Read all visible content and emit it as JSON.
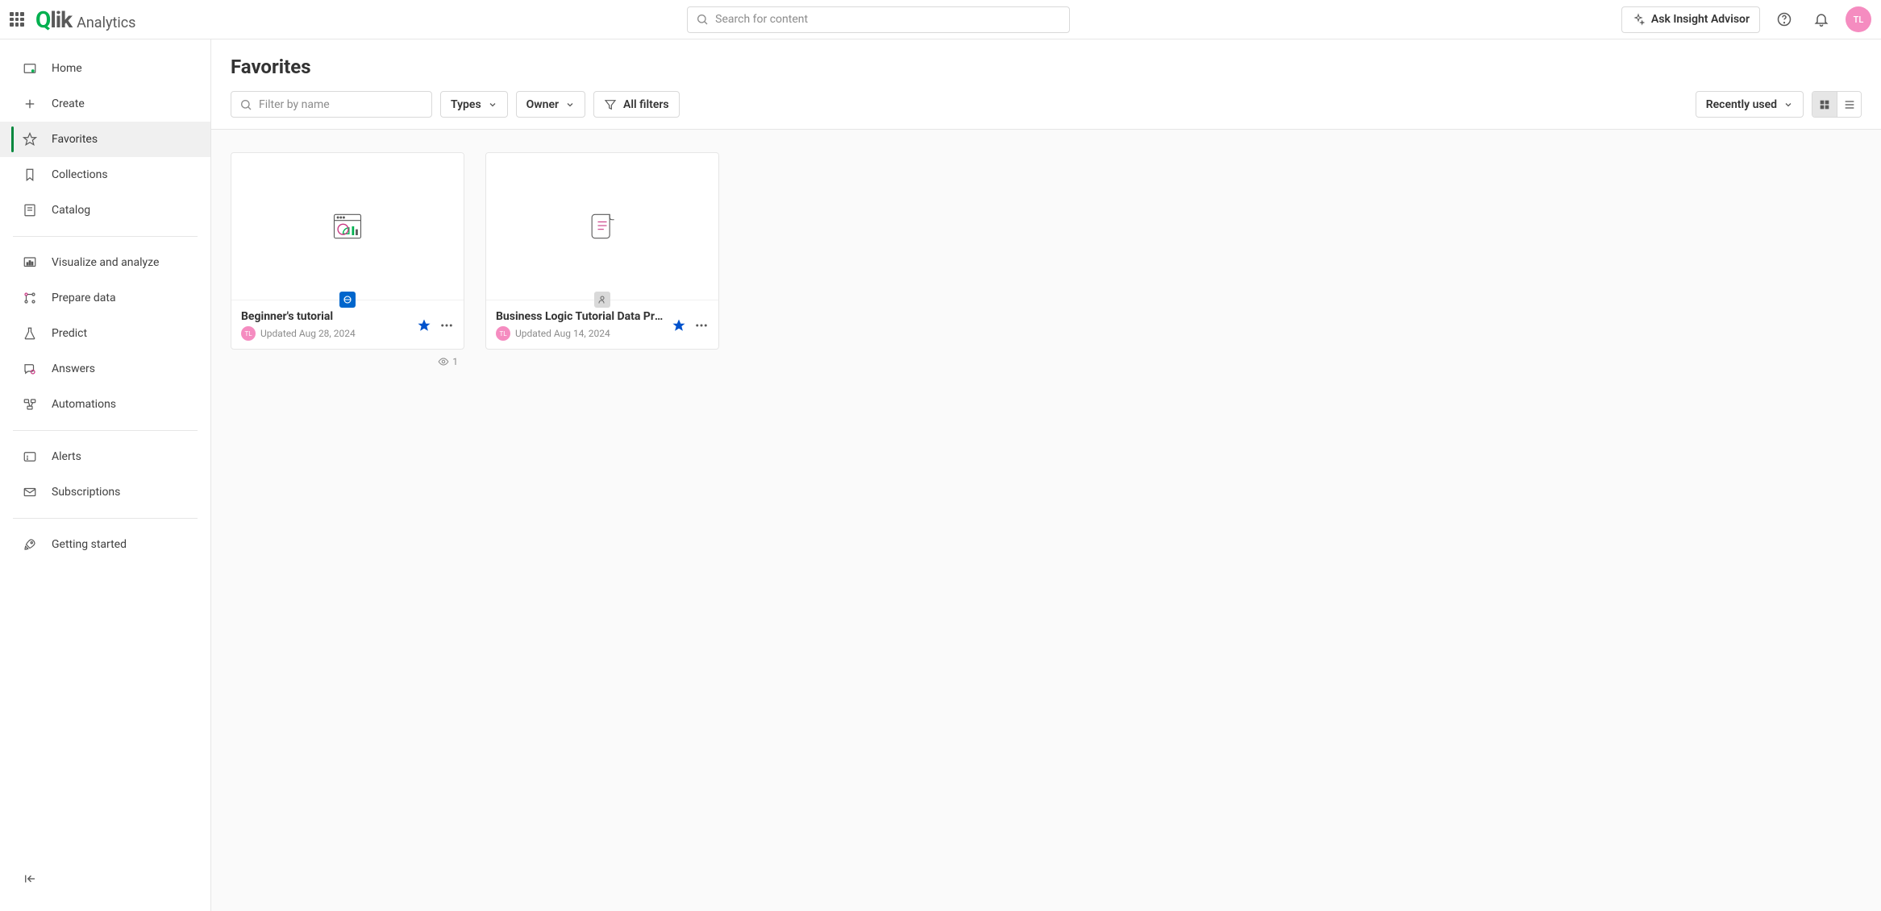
{
  "header": {
    "product": "Analytics",
    "search_placeholder": "Search for content",
    "ask_advisor": "Ask Insight Advisor",
    "user_initials": "TL"
  },
  "sidebar": {
    "items": [
      {
        "label": "Home"
      },
      {
        "label": "Create"
      },
      {
        "label": "Favorites"
      },
      {
        "label": "Collections"
      },
      {
        "label": "Catalog"
      },
      {
        "label": "Visualize and analyze"
      },
      {
        "label": "Prepare data"
      },
      {
        "label": "Predict"
      },
      {
        "label": "Answers"
      },
      {
        "label": "Automations"
      },
      {
        "label": "Alerts"
      },
      {
        "label": "Subscriptions"
      },
      {
        "label": "Getting started"
      }
    ]
  },
  "main": {
    "title": "Favorites",
    "filter_placeholder": "Filter by name",
    "types_label": "Types",
    "owner_label": "Owner",
    "all_filters_label": "All filters",
    "sort_label": "Recently used"
  },
  "cards": [
    {
      "title": "Beginner's tutorial",
      "updated": "Updated Aug 28, 2024",
      "owner_initials": "TL",
      "views": "1",
      "badge": "app"
    },
    {
      "title": "Business Logic Tutorial Data Prep",
      "updated": "Updated Aug 14, 2024",
      "owner_initials": "TL",
      "badge": "script"
    }
  ]
}
